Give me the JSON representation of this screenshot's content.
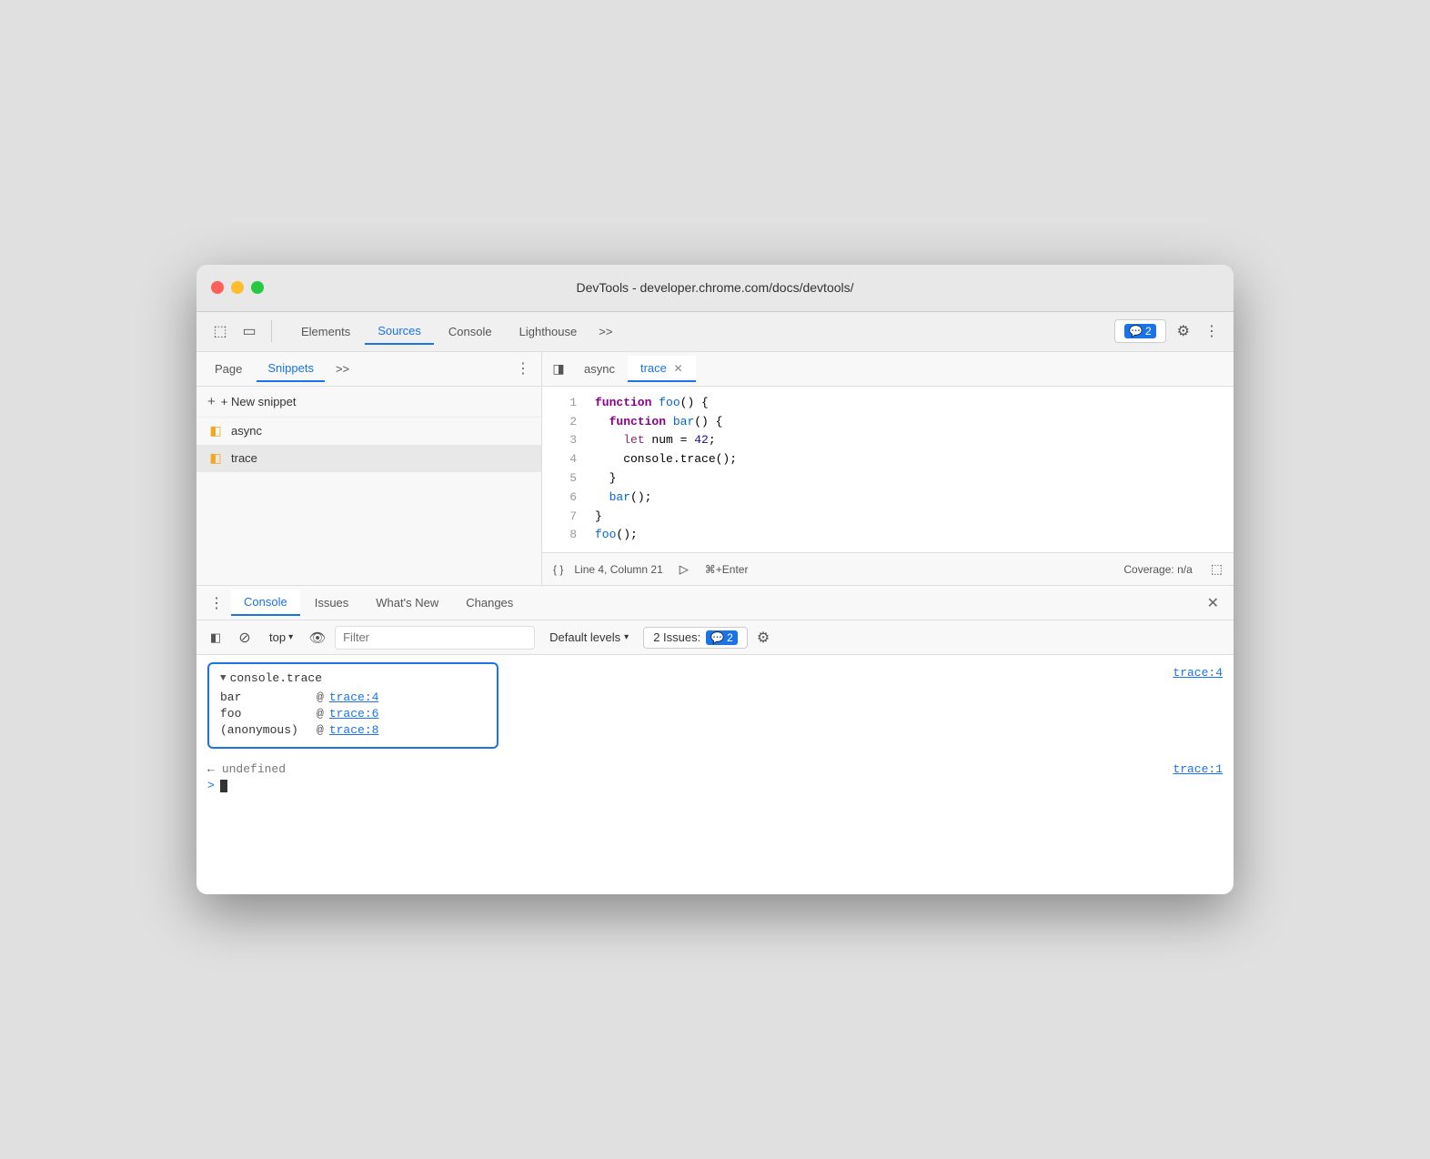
{
  "window": {
    "title": "DevTools - developer.chrome.com/docs/devtools/"
  },
  "main_toolbar": {
    "tabs": [
      {
        "label": "Elements",
        "active": false
      },
      {
        "label": "Sources",
        "active": true
      },
      {
        "label": "Console",
        "active": false
      },
      {
        "label": "Lighthouse",
        "active": false
      },
      {
        "label": ">>",
        "active": false
      }
    ],
    "badge": {
      "count": "2",
      "icon": "💬"
    }
  },
  "sidebar": {
    "tabs": [
      {
        "label": "Page",
        "active": false
      },
      {
        "label": "Snippets",
        "active": true
      },
      {
        "label": ">>",
        "active": false
      }
    ],
    "new_snippet_label": "+ New snippet",
    "items": [
      {
        "name": "async",
        "active": false
      },
      {
        "name": "trace",
        "active": true
      }
    ]
  },
  "editor": {
    "tabs": [
      {
        "label": "async",
        "active": false,
        "closeable": false
      },
      {
        "label": "trace",
        "active": true,
        "closeable": true
      }
    ],
    "lines": [
      {
        "num": "1",
        "code": "function foo() {"
      },
      {
        "num": "2",
        "code": "  function bar() {"
      },
      {
        "num": "3",
        "code": "    let num = 42;"
      },
      {
        "num": "4",
        "code": "    console.trace();"
      },
      {
        "num": "5",
        "code": "  }"
      },
      {
        "num": "6",
        "code": "  bar();"
      },
      {
        "num": "7",
        "code": "}"
      },
      {
        "num": "8",
        "code": "foo();"
      }
    ],
    "status": {
      "curly": "{ }",
      "position": "Line 4, Column 21",
      "run_shortcut": "⌘+Enter",
      "coverage": "Coverage: n/a"
    }
  },
  "bottom_panel": {
    "tabs": [
      {
        "label": "Console",
        "active": true
      },
      {
        "label": "Issues",
        "active": false
      },
      {
        "label": "What's New",
        "active": false
      },
      {
        "label": "Changes",
        "active": false
      }
    ]
  },
  "console_toolbar": {
    "top_label": "top",
    "filter_placeholder": "Filter",
    "levels_label": "Default levels",
    "issues_label": "2 Issues:",
    "issues_count": "2"
  },
  "console": {
    "trace_group": {
      "title": "console.trace",
      "location": "trace:4",
      "rows": [
        {
          "fn": "bar",
          "at": "@",
          "link": "trace:4"
        },
        {
          "fn": "foo",
          "at": "@",
          "link": "trace:6"
        },
        {
          "fn": "(anonymous)",
          "at": "@",
          "link": "trace:8"
        }
      ]
    },
    "undefined_row": {
      "arrow": "←",
      "value": "undefined",
      "location": "trace:1"
    },
    "prompt": ">"
  }
}
